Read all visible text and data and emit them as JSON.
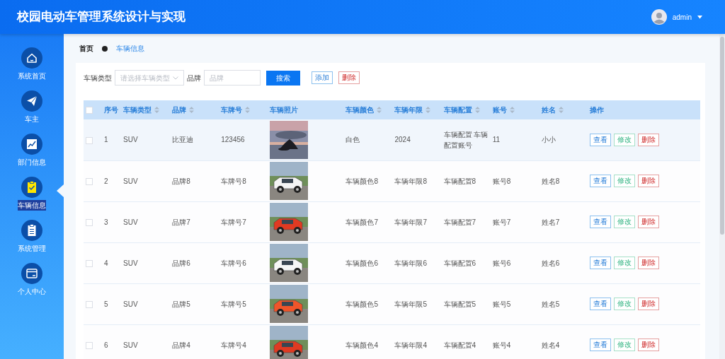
{
  "header": {
    "title": "校园电动车管理系统设计与实现",
    "user": {
      "name": "admin"
    }
  },
  "sidebar": {
    "items": [
      {
        "label": "系统首页",
        "selected": false
      },
      {
        "label": "车主",
        "selected": false
      },
      {
        "label": "部门信息",
        "selected": false
      },
      {
        "label": "车辆信息",
        "selected": true
      },
      {
        "label": "系统管理",
        "selected": false
      },
      {
        "label": "个人中心",
        "selected": false
      }
    ]
  },
  "breadcrumb": [
    {
      "label": "首页",
      "current": false
    },
    {
      "label": "车辆信息",
      "current": true
    }
  ],
  "search": {
    "fields": [
      {
        "kind": "select",
        "label": "车辆类型",
        "placeholder": "请选择车辆类型"
      },
      {
        "kind": "input",
        "label": "品牌",
        "placeholder": "品牌"
      }
    ],
    "buttons": [
      {
        "label": "搜索",
        "kind": "primary"
      },
      {
        "label": "添加",
        "kind": "add"
      },
      {
        "label": "删除",
        "kind": "delete"
      }
    ]
  },
  "table": {
    "select_all": {
      "checked": false
    },
    "columns": [
      {
        "label": "序号",
        "kind": "text",
        "sortable": false
      },
      {
        "label": "车辆类型",
        "kind": "text",
        "sortable": true
      },
      {
        "label": "品牌",
        "kind": "text",
        "sortable": true
      },
      {
        "label": "车牌号",
        "kind": "text",
        "sortable": true
      },
      {
        "label": "车辆照片",
        "kind": "picture",
        "sortable": false
      },
      {
        "label": "车辆颜色",
        "kind": "text",
        "sortable": true
      },
      {
        "label": "车辆年限",
        "kind": "text",
        "sortable": true
      },
      {
        "label": "车辆配置",
        "kind": "text",
        "sortable": true
      },
      {
        "label": "账号",
        "kind": "text",
        "sortable": true
      },
      {
        "label": "姓名",
        "kind": "text",
        "sortable": true
      },
      {
        "label": "操作",
        "kind": "actions",
        "sortable": false
      }
    ],
    "rows": [
      {
        "checked": false,
        "hovered": true,
        "cells": [
          "1",
          "SUV",
          "比亚迪",
          "123456",
          "",
          "白色",
          "2024",
          "车辆配置 车辆配置账号",
          "11",
          "小小"
        ],
        "actions": [
          {
            "label": "查看",
            "kind": "view"
          },
          {
            "label": "修改",
            "kind": "edit"
          },
          {
            "label": "删除",
            "kind": "delete"
          }
        ]
      },
      {
        "checked": false,
        "hovered": false,
        "cells": [
          "2",
          "SUV",
          "品牌8",
          "车牌号8",
          "",
          "车辆颜色8",
          "车辆年限8",
          "车辆配置8",
          "账号8",
          "姓名8"
        ],
        "actions": [
          {
            "label": "查看",
            "kind": "view"
          },
          {
            "label": "修改",
            "kind": "edit"
          },
          {
            "label": "删除",
            "kind": "delete"
          }
        ]
      },
      {
        "checked": false,
        "hovered": false,
        "cells": [
          "3",
          "SUV",
          "品牌7",
          "车牌号7",
          "",
          "车辆颜色7",
          "车辆年限7",
          "车辆配置7",
          "账号7",
          "姓名7"
        ],
        "actions": [
          {
            "label": "查看",
            "kind": "view"
          },
          {
            "label": "修改",
            "kind": "edit"
          },
          {
            "label": "删除",
            "kind": "delete"
          }
        ]
      },
      {
        "checked": false,
        "hovered": false,
        "cells": [
          "4",
          "SUV",
          "品牌6",
          "车牌号6",
          "",
          "车辆颜色6",
          "车辆年限6",
          "车辆配置6",
          "账号6",
          "姓名6"
        ],
        "actions": [
          {
            "label": "查看",
            "kind": "view"
          },
          {
            "label": "修改",
            "kind": "edit"
          },
          {
            "label": "删除",
            "kind": "delete"
          }
        ]
      },
      {
        "checked": false,
        "hovered": false,
        "cells": [
          "5",
          "SUV",
          "品牌5",
          "车牌号5",
          "",
          "车辆颜色5",
          "车辆年限5",
          "车辆配置5",
          "账号5",
          "姓名5"
        ],
        "actions": [
          {
            "label": "查看",
            "kind": "view"
          },
          {
            "label": "修改",
            "kind": "edit"
          },
          {
            "label": "删除",
            "kind": "delete"
          }
        ]
      },
      {
        "checked": false,
        "hovered": false,
        "cells": [
          "6",
          "SUV",
          "品牌4",
          "车牌号4",
          "",
          "车辆颜色4",
          "车辆年限4",
          "车辆配置4",
          "账号4",
          "姓名4"
        ],
        "actions": [
          {
            "label": "查看",
            "kind": "view"
          },
          {
            "label": "修改",
            "kind": "edit"
          },
          {
            "label": "删除",
            "kind": "delete"
          }
        ]
      }
    ]
  }
}
